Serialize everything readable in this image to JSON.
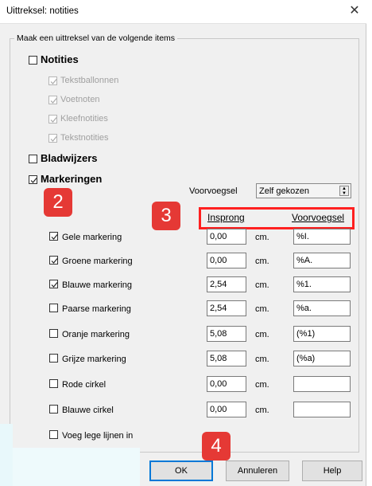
{
  "window": {
    "title": "Uittreksel: notities",
    "close_glyph": "✕"
  },
  "group_title": "Maak een uittreksel van de volgende items",
  "sections": {
    "notities": {
      "label": "Notities",
      "checked": false,
      "items": [
        {
          "label": "Tekstballonnen",
          "checked": true,
          "disabled": true
        },
        {
          "label": "Voetnoten",
          "checked": true,
          "disabled": true
        },
        {
          "label": "Kleefnotities",
          "checked": true,
          "disabled": true
        },
        {
          "label": "Tekstnotities",
          "checked": true,
          "disabled": true
        }
      ]
    },
    "bladwijzers": {
      "label": "Bladwijzers",
      "checked": false
    },
    "markeringen": {
      "label": "Markeringen",
      "checked": true
    }
  },
  "voorvoegsel": {
    "label": "Voorvoegsel",
    "value": "Zelf gekozen"
  },
  "columns": {
    "insprong": "Insprong",
    "voorvoegsel": "Voorvoegsel"
  },
  "unit": "cm.",
  "markings": [
    {
      "label": "Gele markering",
      "checked": true,
      "indent": "0,00",
      "prefix": "%I."
    },
    {
      "label": "Groene markering",
      "checked": true,
      "indent": "0,00",
      "prefix": "%A."
    },
    {
      "label": "Blauwe markering",
      "checked": true,
      "indent": "2,54",
      "prefix": "%1."
    },
    {
      "label": "Paarse markering",
      "checked": false,
      "indent": "2,54",
      "prefix": "%a."
    },
    {
      "label": "Oranje markering",
      "checked": false,
      "indent": "5,08",
      "prefix": "(%1)"
    },
    {
      "label": "Grijze markering",
      "checked": false,
      "indent": "5,08",
      "prefix": "(%a)"
    },
    {
      "label": "Rode cirkel",
      "checked": false,
      "indent": "0,00",
      "prefix": ""
    },
    {
      "label": "Blauwe cirkel",
      "checked": false,
      "indent": "0,00",
      "prefix": ""
    }
  ],
  "voeg_lege_lijnen": {
    "label": "Voeg lege lijnen in",
    "checked": false
  },
  "buttons": {
    "ok": "OK",
    "annuleren": "Annuleren",
    "help": "Help"
  },
  "annotations": [
    "2",
    "3",
    "4"
  ],
  "colors": {
    "annotation": "#e53935",
    "highlight_box": "#ff2020",
    "focus": "#0078d7"
  }
}
